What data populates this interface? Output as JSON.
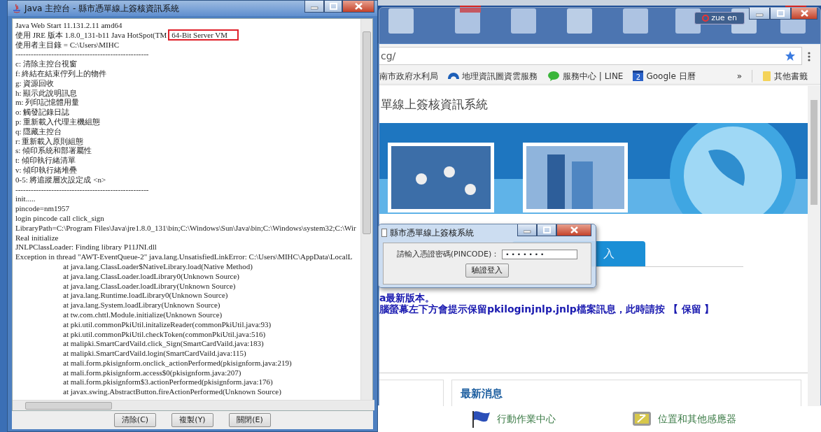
{
  "console_window": {
    "title": "Java 主控台 - 縣市憑單線上簽核資訊系統",
    "lines": [
      {
        "text": "Java Web Start 11.131.2.11 amd64",
        "indent": false
      },
      {
        "text": "使用 JRE 版本 1.8.0_131-b11 Java HotSpot(TM",
        "marked_text": "64-Bit Server VM",
        "indent": false
      },
      {
        "text": "使用者主目錄 = C:\\Users\\MIHC",
        "indent": false
      },
      {
        "text": "----------------------------------------------------",
        "indent": false
      },
      {
        "text": "c:   清除主控台視窗",
        "indent": false
      },
      {
        "text": "f:   終結在結束佇列上的物件",
        "indent": false
      },
      {
        "text": "g:   資源回收",
        "indent": false
      },
      {
        "text": "h:   顯示此說明訊息",
        "indent": false
      },
      {
        "text": "m:   列印記憶體用量",
        "indent": false
      },
      {
        "text": "o:   觸發記錄日誌",
        "indent": false
      },
      {
        "text": "p:   重新載入代理主機組態",
        "indent": false
      },
      {
        "text": "q:   隱藏主控台",
        "indent": false
      },
      {
        "text": "r:   重新載入原則組態",
        "indent": false
      },
      {
        "text": "s:   傾印系統和部署屬性",
        "indent": false
      },
      {
        "text": "t:   傾印執行緒清單",
        "indent": false
      },
      {
        "text": "v:   傾印執行緒堆疊",
        "indent": false
      },
      {
        "text": "0-5: 將追蹤層次設定成 <n>",
        "indent": false
      },
      {
        "text": "----------------------------------------------------",
        "indent": false
      },
      {
        "text": "init.....",
        "indent": false
      },
      {
        "text": "pincode=nm1957",
        "indent": false
      },
      {
        "text": "login pincode call click_sign",
        "indent": false
      },
      {
        "text": "LibraryPath=C:\\Program Files\\Java\\jre1.8.0_131\\bin;C:\\Windows\\Sun\\Java\\bin;C:\\Windows\\system32;C:\\Wir",
        "indent": false
      },
      {
        "text": "Real initialize",
        "indent": false
      },
      {
        "text": "JNLPClassLoader: Finding library P11JNI.dll",
        "indent": false
      },
      {
        "text": "Exception in thread \"AWT-EventQueue-2\" java.lang.UnsatisfiedLinkError: C:\\Users\\MIHC\\AppData\\LocalL",
        "indent": false
      },
      {
        "text": "at java.lang.ClassLoader$NativeLibrary.load(Native Method)",
        "indent": true
      },
      {
        "text": "at java.lang.ClassLoader.loadLibrary0(Unknown Source)",
        "indent": true
      },
      {
        "text": "at java.lang.ClassLoader.loadLibrary(Unknown Source)",
        "indent": true
      },
      {
        "text": "at java.lang.Runtime.loadLibrary0(Unknown Source)",
        "indent": true
      },
      {
        "text": "at java.lang.System.loadLibrary(Unknown Source)",
        "indent": true
      },
      {
        "text": "at tw.com.chttl.Module.initialize(Unknown Source)",
        "indent": true
      },
      {
        "text": "at pki.util.commonPkiUtil.initalizeReader(commonPkiUtil.java:93)",
        "indent": true
      },
      {
        "text": "at pki.util.commonPkiUtil.checkToken(commonPkiUtil.java:516)",
        "indent": true
      },
      {
        "text": "at malipki.SmartCardVaild.click_Sign(SmartCardVaild.java:183)",
        "indent": true
      },
      {
        "text": "at malipki.SmartCardVaild.login(SmartCardVaild.java:115)",
        "indent": true
      },
      {
        "text": "at mali.form.pkisignform.onclick_actionPerformed(pkisignform.java:219)",
        "indent": true
      },
      {
        "text": "at mali.form.pkisignform.access$0(pkisignform.java:207)",
        "indent": true
      },
      {
        "text": "at mali.form.pkisignform$3.actionPerformed(pkisignform.java:176)",
        "indent": true
      },
      {
        "text": "at javax.swing.AbstractButton.fireActionPerformed(Unknown Source)",
        "indent": true
      }
    ],
    "buttons": [
      "清除(C)",
      "複製(Y)",
      "關閉(E)"
    ]
  },
  "browser": {
    "profile": "zue en",
    "address": "cg/",
    "bookmarks": [
      {
        "label": "南市政府水利局",
        "kind": "plain"
      },
      {
        "label": "地理資訊圖資雲服務",
        "kind": "globe"
      },
      {
        "label": "服務中心 | LINE",
        "kind": "chat"
      },
      {
        "label": "Google 日曆",
        "kind": "calendar",
        "icon_text": "2"
      }
    ],
    "more": "»",
    "other_bookmarks": "其他書籤",
    "heading": "單線上簽核資訊系統",
    "login_tab": "入",
    "notices": [
      "a最新版本。",
      "腦螢幕左下方會提示保留pkiloginjnlp.jnlp檔案訊息，此時請按 【 保留 】"
    ],
    "news_title": "最新消息"
  },
  "pin_dialog": {
    "title": "縣市憑單線上簽核系統",
    "label": "請輸入憑證密碼(PINCODE)：",
    "value": "•••••••",
    "button": "驗證登入"
  },
  "control_panel": {
    "items": [
      {
        "label": "行動作業中心",
        "kind": "flag"
      },
      {
        "label": "位置和其他感應器",
        "kind": "sensor"
      }
    ]
  }
}
